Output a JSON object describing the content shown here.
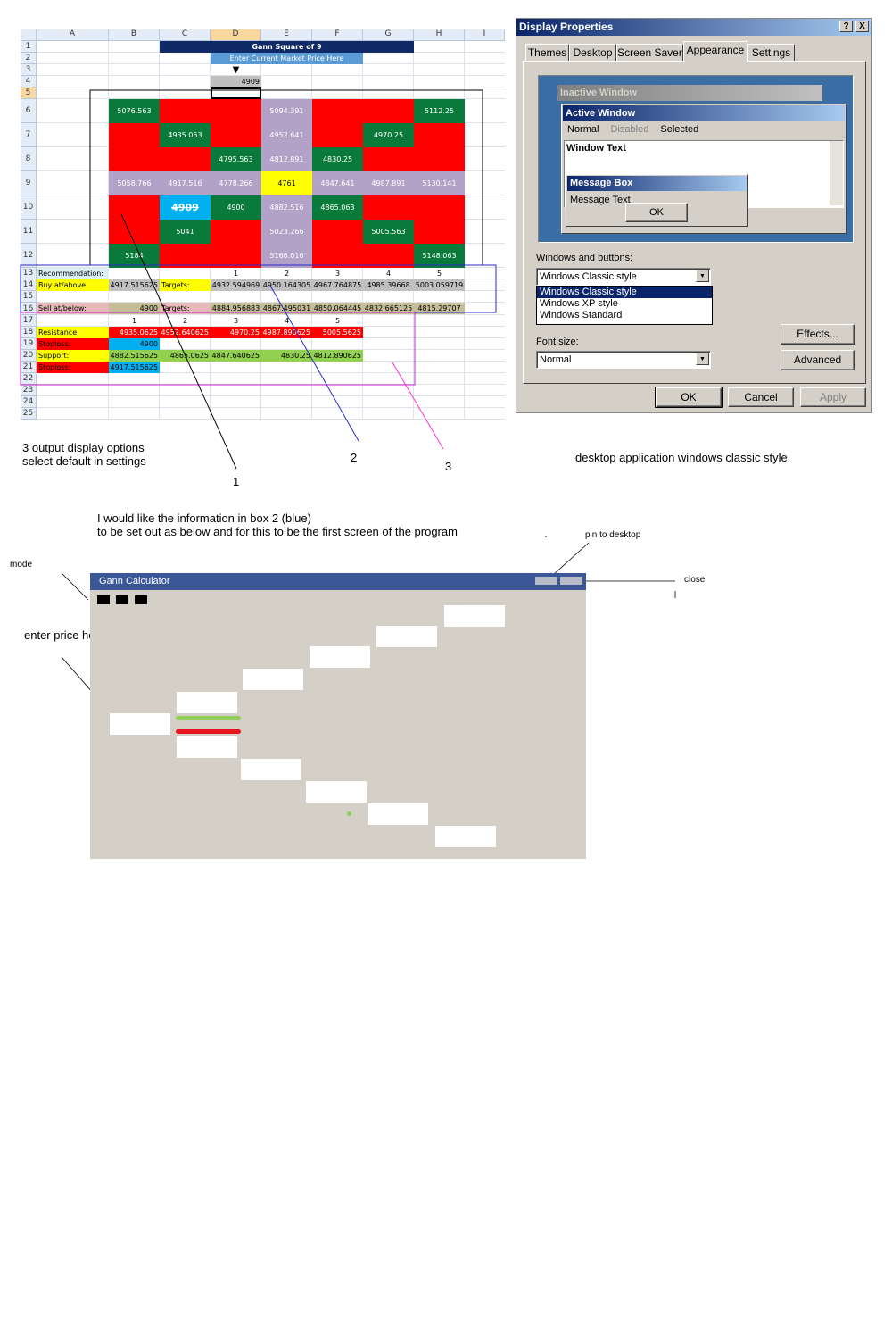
{
  "sheet": {
    "columns": [
      "A",
      "B",
      "C",
      "D",
      "E",
      "F",
      "G",
      "H",
      "I"
    ],
    "rows": [
      "1",
      "2",
      "3",
      "4",
      "5",
      "6",
      "7",
      "8",
      "9",
      "10",
      "11",
      "12",
      "13",
      "14",
      "15",
      "16",
      "17",
      "18",
      "19",
      "20",
      "21",
      "22",
      "23",
      "24",
      "25"
    ],
    "title": "Gann Square of 9",
    "subtitle": "Enter Current Market Price Here",
    "arrow": "▼",
    "price": "4909",
    "grid": [
      [
        "5076.563",
        "",
        "",
        "5094.391",
        "",
        "",
        "5112.25"
      ],
      [
        "",
        "4935.063",
        "",
        "4952.641",
        "",
        "4970.25",
        ""
      ],
      [
        "",
        "",
        "4795.563",
        "4812.891",
        "4830.25",
        "",
        ""
      ],
      [
        "5058.766",
        "4917.516",
        "4778.266",
        "4761",
        "4847.641",
        "4987.891",
        "5130.141"
      ],
      [
        "",
        "4909",
        "4900",
        "4882.516",
        "4865.063",
        "",
        ""
      ],
      [
        "",
        "5041",
        "",
        "5023.266",
        "",
        "5005.563",
        ""
      ],
      [
        "5184",
        "",
        "",
        "5166.016",
        "",
        "",
        "5148.063"
      ]
    ],
    "recommendation": "Recommendation:",
    "target_numbers": [
      "1",
      "2",
      "3",
      "4",
      "5"
    ],
    "buy_label": "Buy at/above",
    "buy_value": "4917.515625",
    "targets_label": "Targets:",
    "buy_targets": [
      "4932.594969",
      "4950.164305",
      "4967.764875",
      "4985.39668",
      "5003.059719"
    ],
    "sell_label": "Sell at/below:",
    "sell_value": "4900",
    "sell_targets": [
      "4884.956883",
      "4867.495031",
      "4850.064445",
      "4832.665125",
      "4815.29707"
    ],
    "level_numbers": [
      "1",
      "2",
      "3",
      "4",
      "5"
    ],
    "resistance_label": "Resistance:",
    "resistance": [
      "4935.0625",
      "4952.640625",
      "4970.25",
      "4987.890625",
      "5005.5625"
    ],
    "stoploss_label": "Stoploss:",
    "stoploss_1": "4900",
    "support_label": "Support:",
    "support": [
      "4882.515625",
      "4865.0625",
      "4847.640625",
      "4830.25",
      "4812.890625"
    ],
    "stoploss_2": "4917.515625"
  },
  "dialog": {
    "title": "Display Properties",
    "help_btn": "?",
    "close_btn": "X",
    "tabs": [
      "Themes",
      "Desktop",
      "Screen Saver",
      "Appearance",
      "Settings"
    ],
    "preview": {
      "inactive_title": "Inactive Window",
      "active_title": "Active Window",
      "menu": [
        "Normal",
        "Disabled",
        "Selected"
      ],
      "window_text": "Window Text",
      "msgbox_title": "Message Box",
      "msgbox_text": "Message Text",
      "msgbox_ok": "OK"
    },
    "windows_buttons_label": "Windows and buttons:",
    "windows_buttons_value": "Windows Classic style",
    "dropdown_options": [
      "Windows Classic style",
      "Windows XP style",
      "Windows Standard"
    ],
    "font_size_label": "Font size:",
    "font_size_value": "Normal",
    "effects_btn": "Effects...",
    "advanced_btn": "Advanced",
    "ok_btn": "OK",
    "cancel_btn": "Cancel",
    "apply_btn": "Apply",
    "colors": {
      "title_start": "#0a246a",
      "title_end": "#a6caf0",
      "face": "#d4d0c8",
      "desktop": "#3a6ea5"
    }
  },
  "annotations": {
    "output_options": "3 output display options\nselect default in settings",
    "callout_1": "1",
    "callout_2": "2",
    "callout_3": "3",
    "desktop_app": "desktop application windows classic style",
    "intro": "I would like the information in box 2 (blue)\nto be set out as below and for this to be the first screen of the program",
    "pin": "pin to desktop",
    "mode": "mode",
    "close": "close",
    "enter_price": "enter price here"
  },
  "gann": {
    "title": "Gann Calculator",
    "colors": {
      "titlebar": "#3b5798",
      "face": "#d4d0c8",
      "buy_line": "#8fce5a",
      "sell_line": "#e8141e"
    }
  }
}
